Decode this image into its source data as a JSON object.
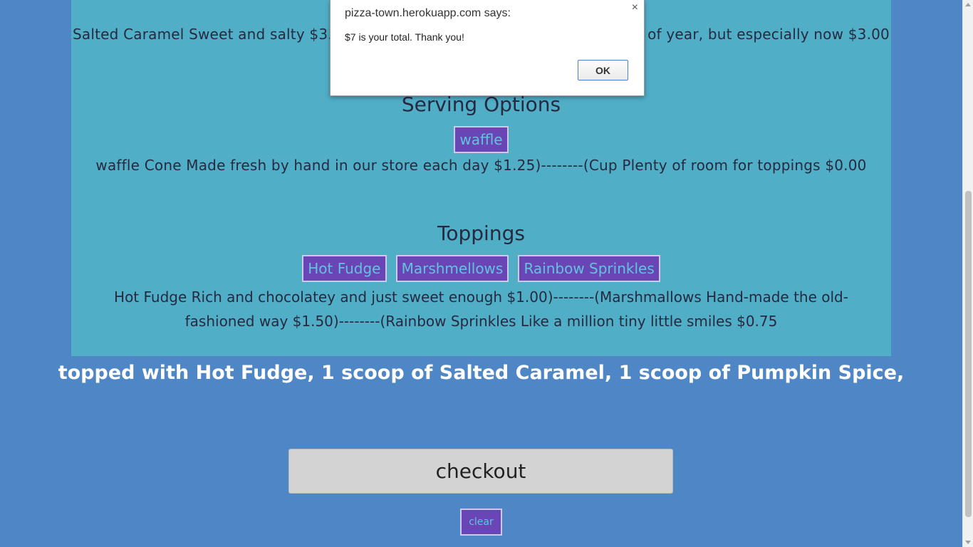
{
  "menu": {
    "flavors_left": "Salted Caramel Sweet and salty $3.",
    "flavors_right": "e of year, but especially now $3.00",
    "serving": {
      "title": "Serving Options",
      "button": "waffle",
      "description": "waffle Cone Made fresh by hand in our store each day $1.25)--------(Cup Plenty of room for toppings $0.00"
    },
    "toppings": {
      "title": "Toppings",
      "buttons": [
        "Hot Fudge",
        "Marshmellows",
        "Rainbow Sprinkles"
      ],
      "description": "Hot Fudge Rich and chocolatey and just sweet enough $1.00)--------(Marshmallows Hand-made the old-fashioned way $1.50)--------(Rainbow Sprinkles Like a million tiny little smiles $0.75"
    }
  },
  "order_summary": "topped with Hot Fudge, 1 scoop of Salted Caramel, 1 scoop of Pumpkin Spice,",
  "checkout_label": "checkout",
  "clear_label": "clear",
  "dialog": {
    "title": "pizza-town.herokuapp.com says:",
    "message": "$7 is your total. Thank you!",
    "ok_label": "OK",
    "close_glyph": "×"
  },
  "colors": {
    "page_bg": "#4f86c6",
    "panel_bg": "#50aec7",
    "button_bg": "#6a45b6",
    "button_text": "#62c3dc",
    "checkout_bg": "#d3d3d3"
  }
}
